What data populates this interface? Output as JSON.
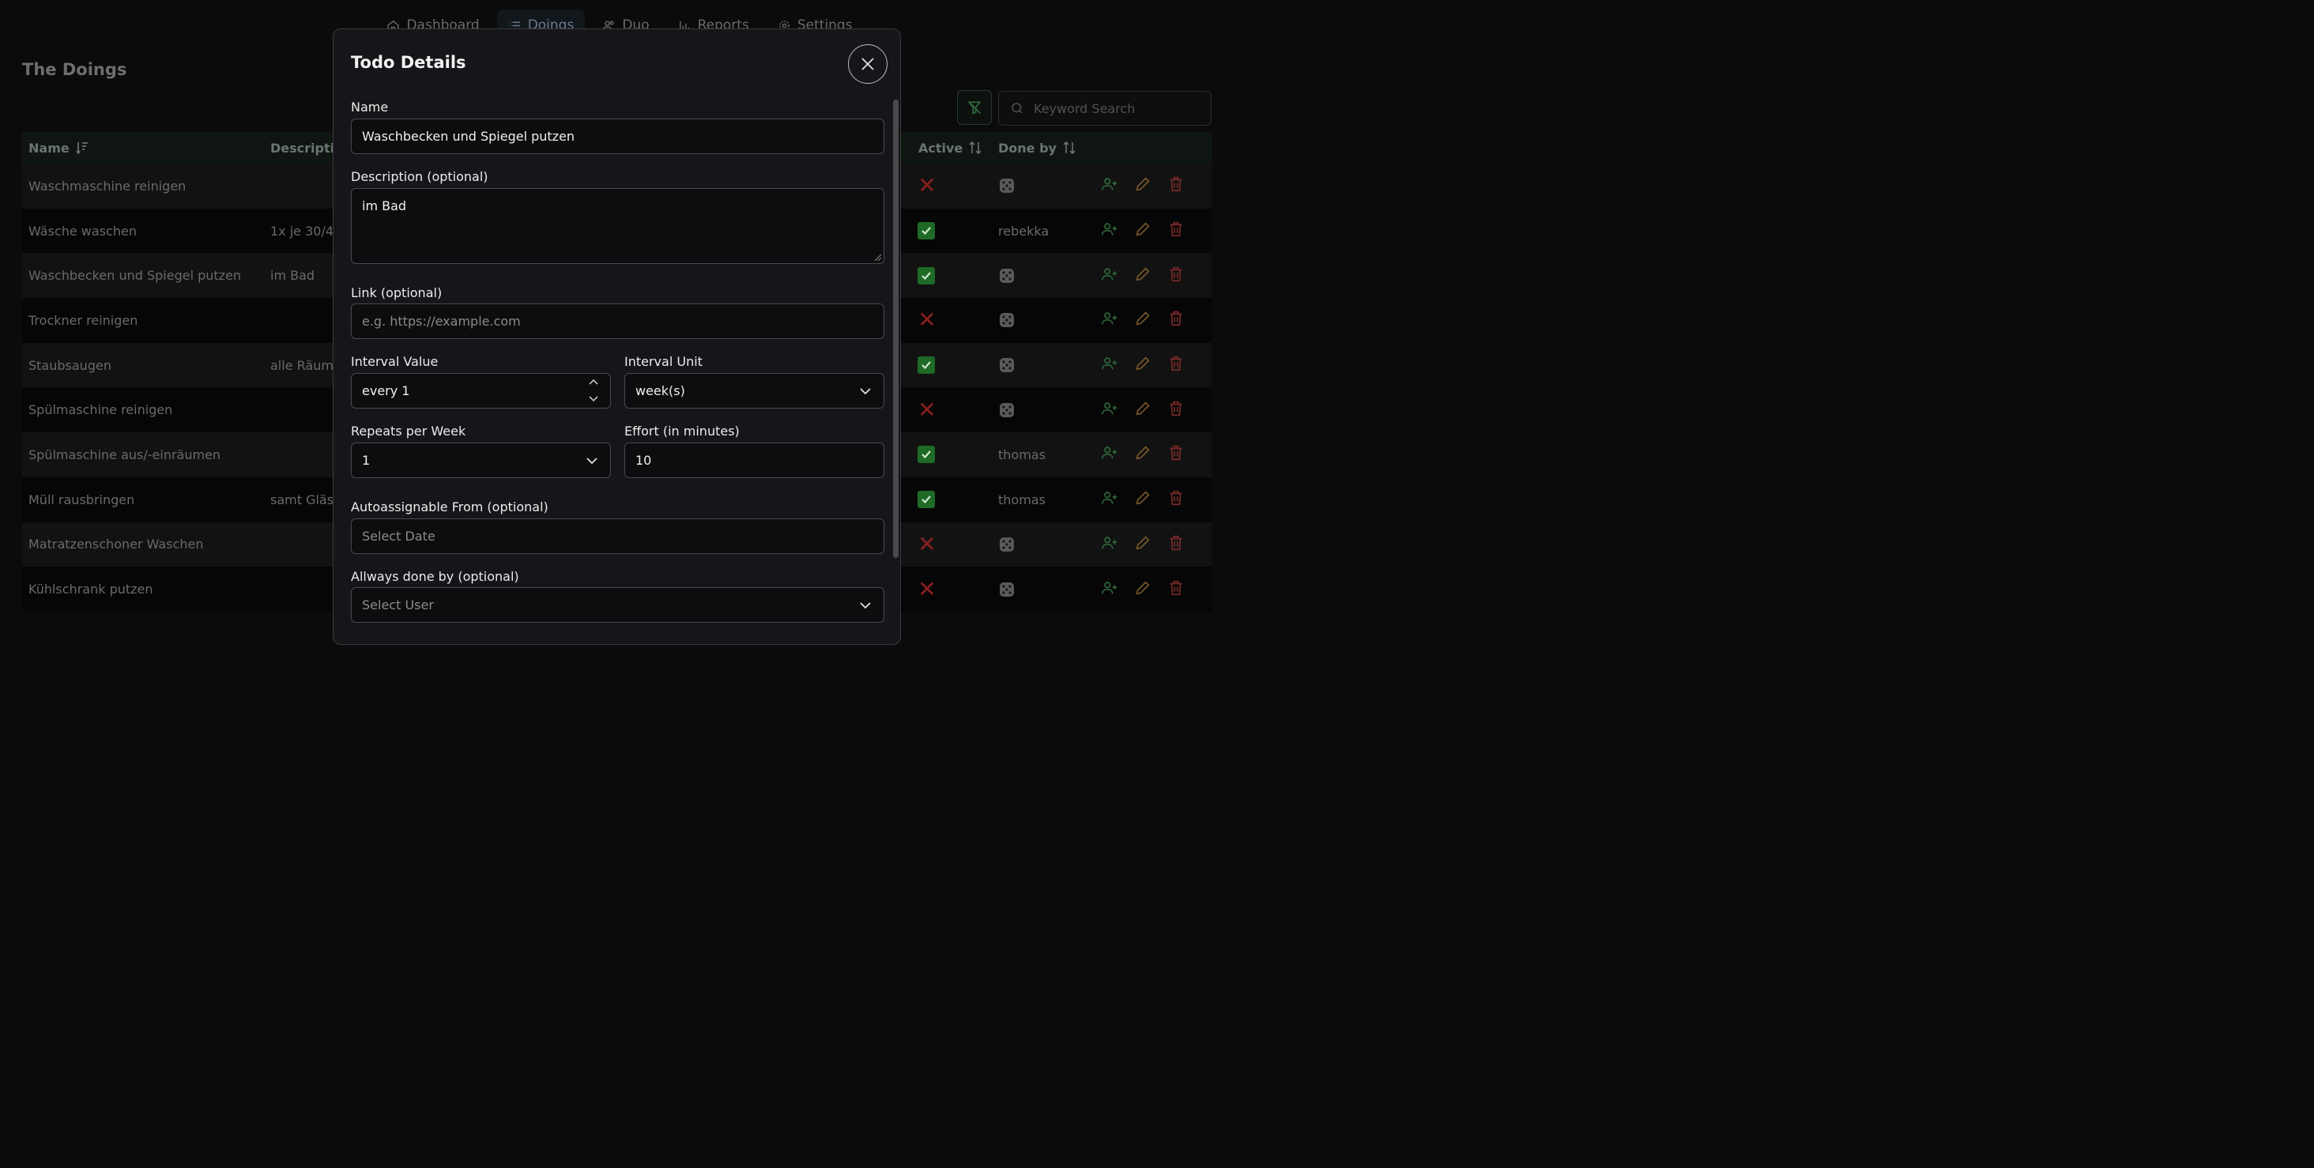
{
  "nav": {
    "items": [
      {
        "label": "Dashboard",
        "icon": "home-icon"
      },
      {
        "label": "Doings",
        "icon": "list-icon",
        "active": true
      },
      {
        "label": "Duo",
        "icon": "users-icon"
      },
      {
        "label": "Reports",
        "icon": "chart-icon"
      },
      {
        "label": "Settings",
        "icon": "gear-icon"
      }
    ]
  },
  "page": {
    "title": "The Doings",
    "search_placeholder": "Keyword Search"
  },
  "table": {
    "columns": {
      "name": "Name",
      "description": "Descriptio",
      "active": "Active",
      "done_by": "Done by"
    },
    "rows": [
      {
        "name": "Waschmaschine reinigen",
        "description": "",
        "active": false,
        "done_by": ""
      },
      {
        "name": "Wäsche waschen",
        "description": "1x je 30/4",
        "active": true,
        "done_by": "rebekka"
      },
      {
        "name": "Waschbecken und Spiegel putzen",
        "description": "im Bad",
        "active": true,
        "done_by": ""
      },
      {
        "name": "Trockner reinigen",
        "description": "",
        "active": false,
        "done_by": ""
      },
      {
        "name": "Staubsaugen",
        "description": "alle Räum",
        "active": true,
        "done_by": ""
      },
      {
        "name": "Spülmaschine reinigen",
        "description": "",
        "active": false,
        "done_by": ""
      },
      {
        "name": "Spülmaschine aus/-einräumen",
        "description": "",
        "active": true,
        "done_by": "thomas"
      },
      {
        "name": "Müll rausbringen",
        "description": "samt Gläs",
        "active": true,
        "done_by": "thomas"
      },
      {
        "name": "Matratzenschoner Waschen",
        "description": "",
        "active": false,
        "done_by": ""
      },
      {
        "name": "Kühlschrank putzen",
        "description": "",
        "active": false,
        "done_by": ""
      }
    ]
  },
  "modal": {
    "title": "Todo Details",
    "name_label": "Name",
    "name_value": "Waschbecken und Spiegel putzen",
    "description_label": "Description (optional)",
    "description_value": "im Bad",
    "link_label": "Link (optional)",
    "link_placeholder": "e.g. https://example.com",
    "interval_value_label": "Interval Value",
    "interval_value": "every 1",
    "interval_unit_label": "Interval Unit",
    "interval_unit": "week(s)",
    "repeats_label": "Repeats per Week",
    "repeats_value": "1",
    "effort_label": "Effort (in minutes)",
    "effort_value": "10",
    "autoassign_label": "Autoassignable From (optional)",
    "autoassign_placeholder": "Select Date",
    "always_label": "Allways done by (optional)",
    "always_placeholder": "Select User"
  },
  "colors": {
    "active_yes": "#1e6a26",
    "active_no": "#8a1f1f",
    "assign_icon": "#2f6a3a",
    "edit_icon": "#7a5a2a",
    "delete_icon": "#7a2a2a"
  }
}
